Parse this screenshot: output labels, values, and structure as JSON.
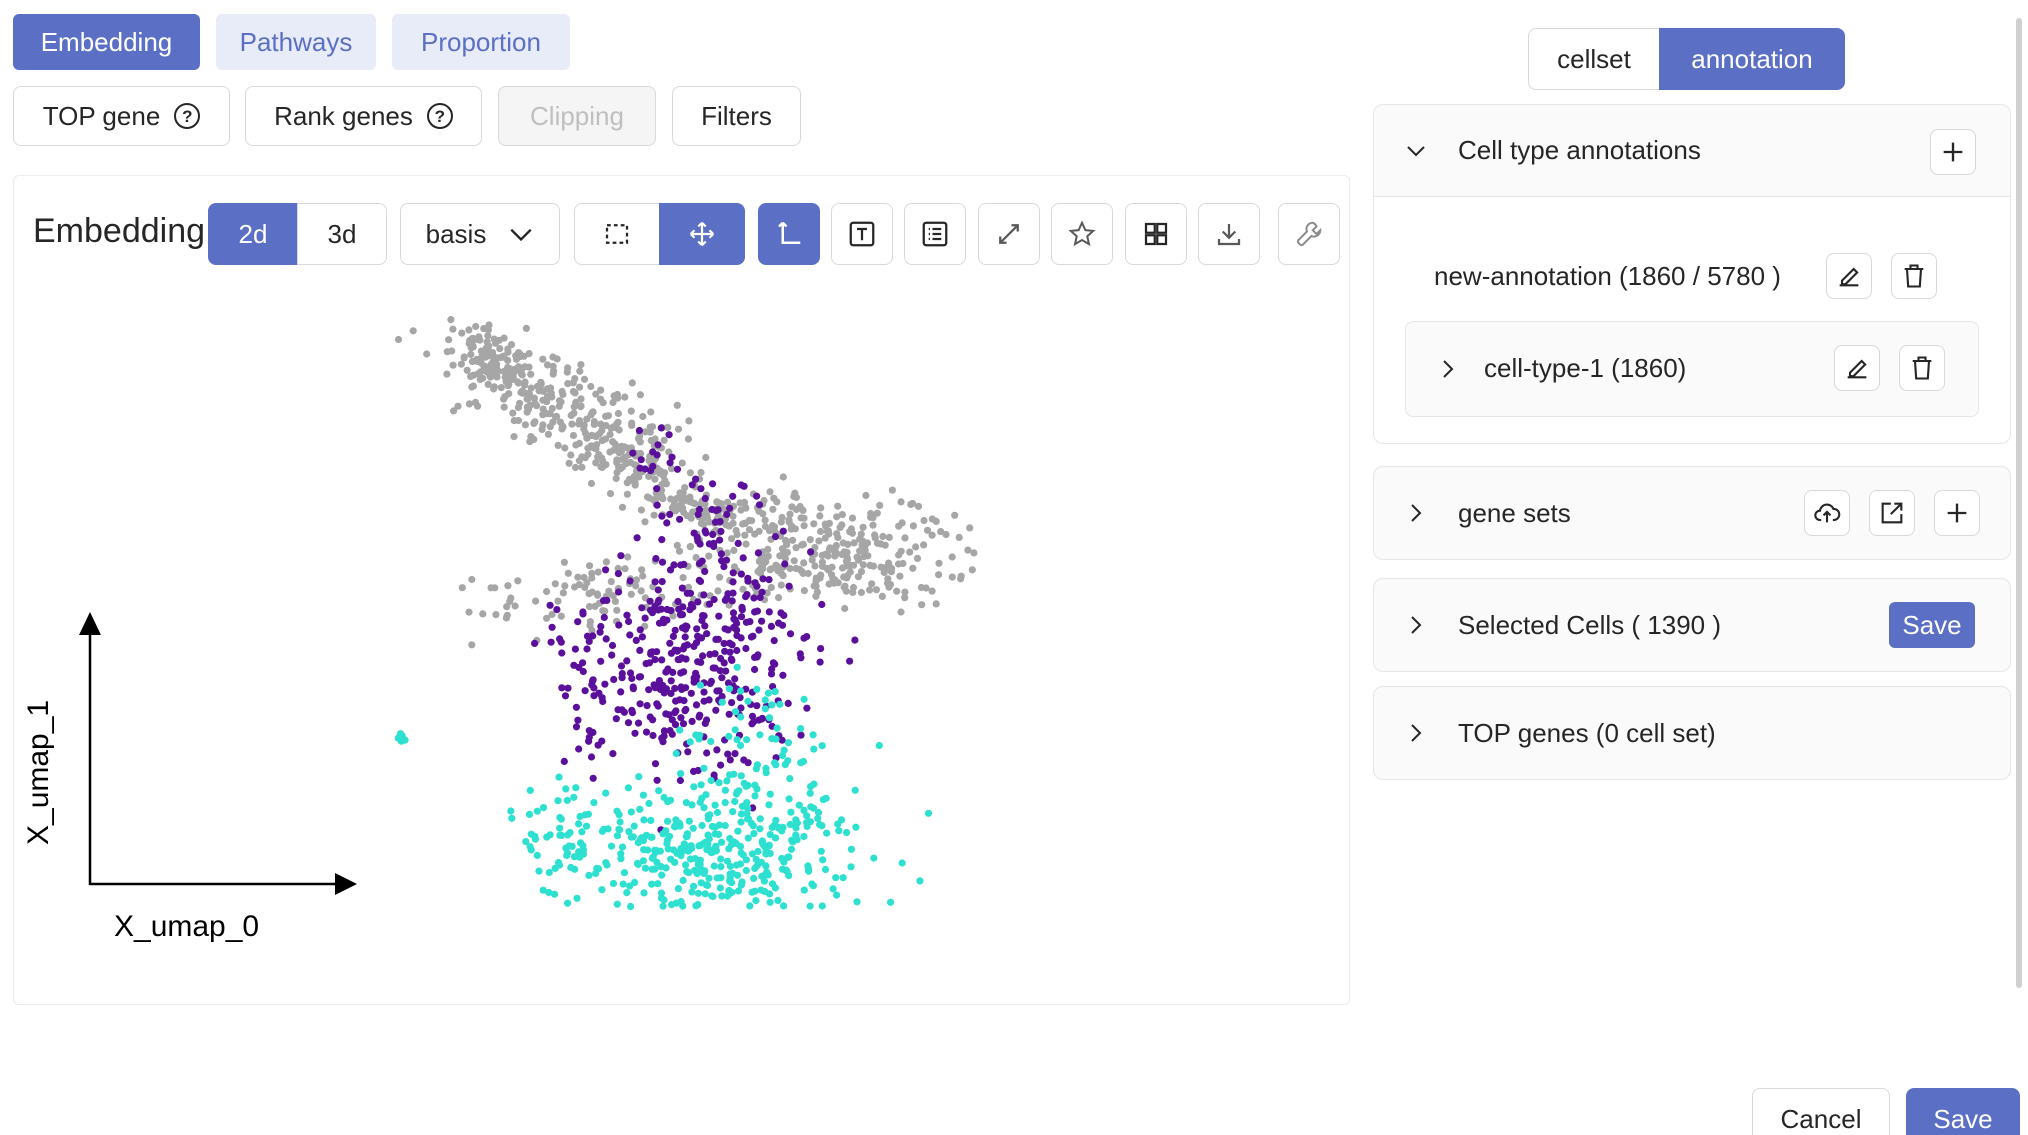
{
  "top_tabs": [
    {
      "label": "Embedding",
      "active": true
    },
    {
      "label": "Pathways",
      "active": false
    },
    {
      "label": "Proportion",
      "active": false
    }
  ],
  "sub_buttons": {
    "top_gene": "TOP gene",
    "rank_genes": "Rank genes",
    "clipping": "Clipping",
    "filters": "Filters"
  },
  "embedding": {
    "title": "Embedding",
    "dims": [
      "2d",
      "3d"
    ],
    "active_dim": "2d",
    "basis_label": "basis",
    "x_axis": "X_umap_0",
    "y_axis": "X_umap_1",
    "colors": {
      "unselected": "#a6a6a6",
      "cell_type_1": "#5b109c",
      "selected": "#2ee0cf"
    }
  },
  "toolbar_icons": [
    "lasso-select-icon",
    "pan-icon",
    "axes-icon",
    "text-icon",
    "list-icon",
    "expand-icon",
    "star-icon",
    "grid-icon",
    "download-icon",
    "wrench-icon"
  ],
  "right": {
    "toggle": [
      "cellset",
      "annotation"
    ],
    "active_toggle": "annotation",
    "cell_type_annotations": {
      "title": "Cell type annotations",
      "annotation_name": "new-annotation (1860 / 5780 )",
      "child": "cell-type-1 (1860)"
    },
    "gene_sets": {
      "title": "gene sets"
    },
    "selected_cells": {
      "title": "Selected Cells ( 1390 )",
      "save": "Save"
    },
    "top_genes": {
      "title": "TOP genes (0 cell set)"
    }
  },
  "footer": {
    "cancel": "Cancel",
    "save": "Save"
  },
  "accent_color": "#5b6fc5"
}
